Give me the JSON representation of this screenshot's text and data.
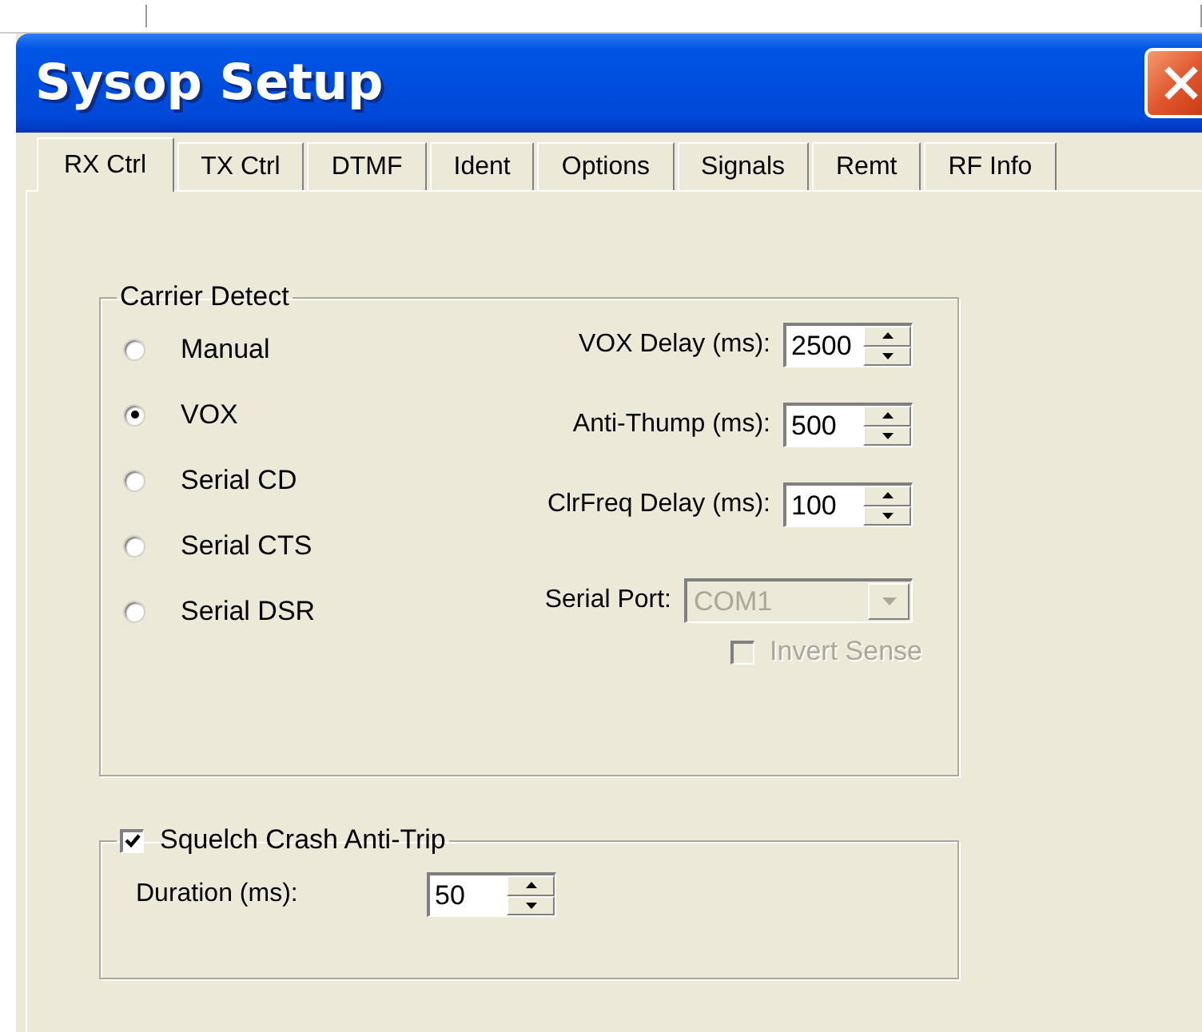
{
  "window": {
    "title": "Sysop Setup"
  },
  "tabs": [
    {
      "label": "RX Ctrl",
      "selected": true
    },
    {
      "label": "TX Ctrl",
      "selected": false
    },
    {
      "label": "DTMF",
      "selected": false
    },
    {
      "label": "Ident",
      "selected": false
    },
    {
      "label": "Options",
      "selected": false
    },
    {
      "label": "Signals",
      "selected": false
    },
    {
      "label": "Remt",
      "selected": false
    },
    {
      "label": "RF Info",
      "selected": false
    }
  ],
  "carrier_detect": {
    "title": "Carrier Detect",
    "options": [
      {
        "label": "Manual",
        "selected": false
      },
      {
        "label": "VOX",
        "selected": true
      },
      {
        "label": "Serial CD",
        "selected": false
      },
      {
        "label": "Serial CTS",
        "selected": false
      },
      {
        "label": "Serial DSR",
        "selected": false
      }
    ],
    "fields": [
      {
        "kind": "spin",
        "label": "VOX Delay (ms):",
        "value": "2500"
      },
      {
        "kind": "spin",
        "label": "Anti-Thump (ms):",
        "value": "500"
      },
      {
        "kind": "spin",
        "label": "ClrFreq Delay (ms):",
        "value": "100"
      },
      {
        "kind": "dropdown",
        "label": "Serial Port:",
        "value": "COM1",
        "disabled": true
      }
    ],
    "invert_sense": {
      "label": "Invert Sense",
      "checked": false,
      "disabled": true
    }
  },
  "squelch_crash": {
    "label": "Squelch Crash Anti-Trip",
    "checked": true,
    "fields": [
      {
        "kind": "spin",
        "label": "Duration (ms):",
        "value": "50"
      }
    ]
  }
}
